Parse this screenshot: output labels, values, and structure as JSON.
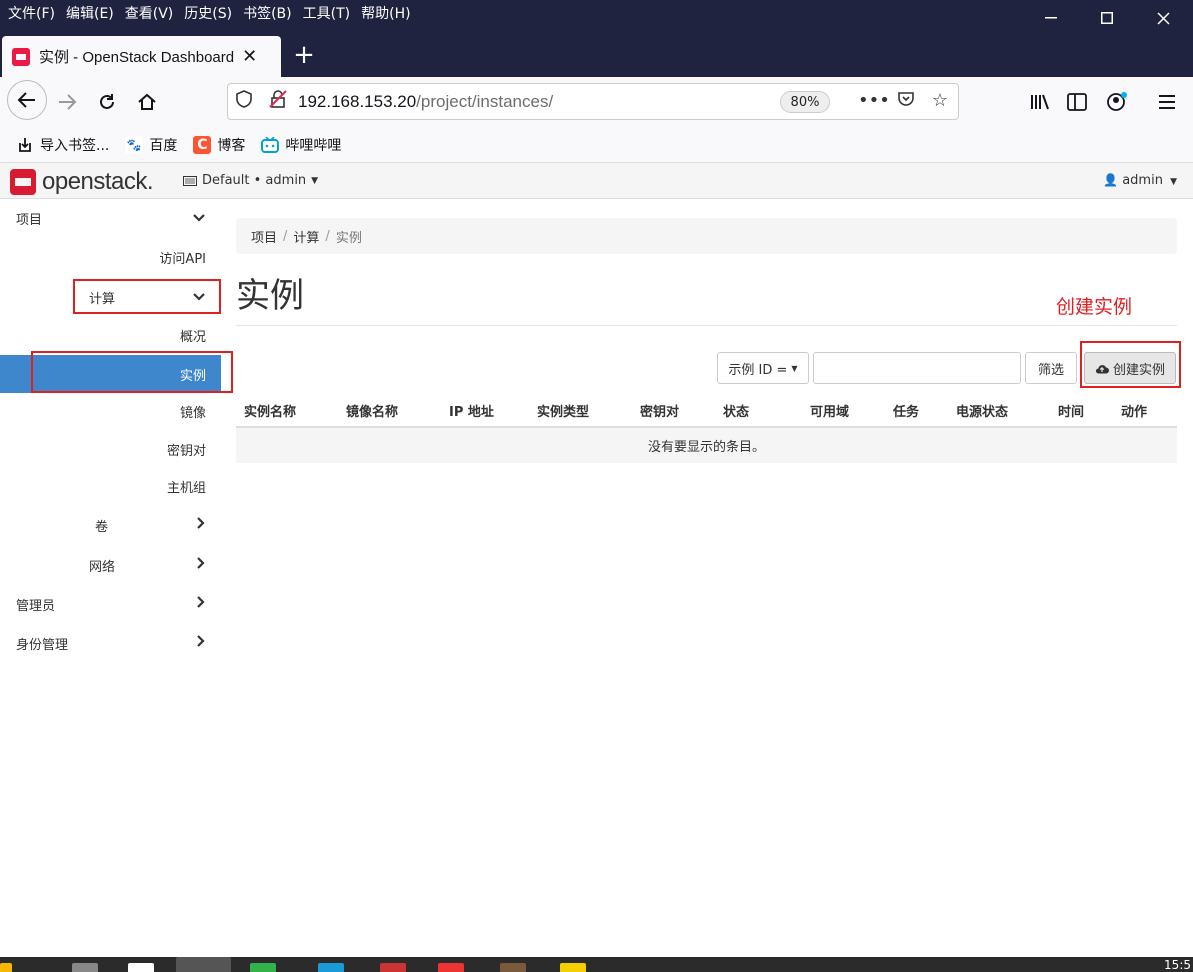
{
  "browser": {
    "menu": [
      "文件(F)",
      "编辑(E)",
      "查看(V)",
      "历史(S)",
      "书签(B)",
      "工具(T)",
      "帮助(H)"
    ],
    "tab_title": "实例 - OpenStack Dashboard",
    "url_host": "192.168.153.20",
    "url_path": "/project/instances/",
    "zoom": "80%",
    "bookmarks": [
      "导入书签...",
      "百度",
      "博客",
      "哔哩哔哩"
    ]
  },
  "header": {
    "logo": "openstack.",
    "project": "Default • admin",
    "user": "admin"
  },
  "sidebar": {
    "items": [
      {
        "label": "项目"
      },
      {
        "label": "访问API"
      },
      {
        "label": "计算"
      },
      {
        "label": "概况"
      },
      {
        "label": "实例"
      },
      {
        "label": "镜像"
      },
      {
        "label": "密钥对"
      },
      {
        "label": "主机组"
      },
      {
        "label": "卷"
      },
      {
        "label": "网络"
      },
      {
        "label": "管理员"
      },
      {
        "label": "身份管理"
      }
    ]
  },
  "breadcrumb": [
    "项目",
    "计算",
    "实例"
  ],
  "page": {
    "title": "实例",
    "annotation": "创建实例"
  },
  "toolbar": {
    "filter_select": "示例 ID =",
    "filter_button": "筛选",
    "create_button": "创建实例"
  },
  "table": {
    "columns": [
      "实例名称",
      "镜像名称",
      "IP 地址",
      "实例类型",
      "密钥对",
      "状态",
      "可用域",
      "任务",
      "电源状态",
      "时间",
      "动作"
    ],
    "empty_message": "没有要显示的条目。"
  },
  "taskbar": {
    "clock": "15:5"
  }
}
